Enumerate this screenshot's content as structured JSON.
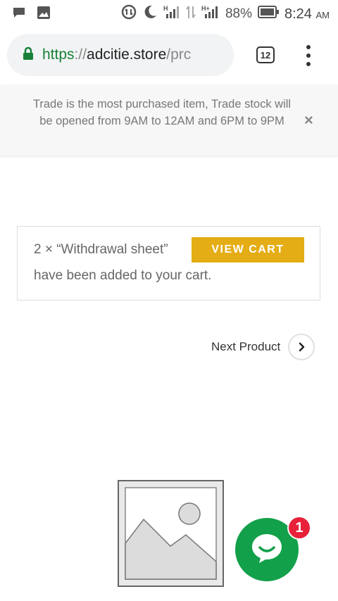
{
  "status_bar": {
    "battery": "88%",
    "time": "8:24",
    "ampm": "AM",
    "network_labels": [
      "H",
      "H+"
    ]
  },
  "browser": {
    "url_scheme": "https",
    "url_separator": "://",
    "url_host": "adcitie.store",
    "url_path": "/prc",
    "tab_count": "12"
  },
  "notice": {
    "text": "Trade is the most purchased item, Trade stock will be opened from 9AM to 12AM and 6PM to 9PM",
    "close_label": "×"
  },
  "cart_message": {
    "line1": "2 × “Withdrawal sheet”",
    "button": "VIEW CART",
    "line2": "have been added to your cart."
  },
  "navigation": {
    "next_product": "Next Product"
  },
  "chat": {
    "badge_count": "1"
  },
  "colors": {
    "accent": "#e4ad15",
    "chat": "#13a04a",
    "badge": "#e8203a",
    "secure": "#188038"
  }
}
